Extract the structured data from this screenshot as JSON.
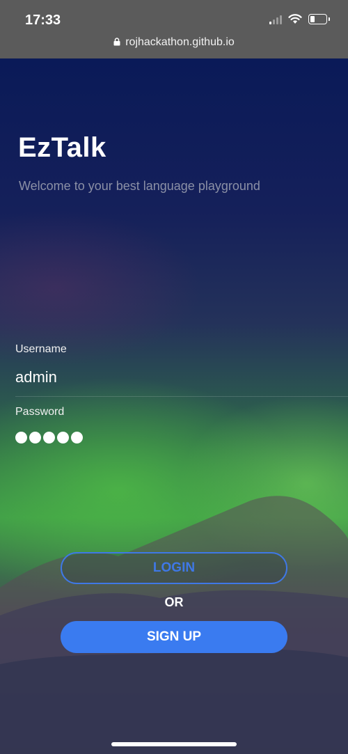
{
  "status_bar": {
    "time": "17:33",
    "url": "rojhackathon.github.io"
  },
  "app": {
    "title": "EzTalk",
    "subtitle": "Welcome to your best language playground"
  },
  "form": {
    "username_label": "Username",
    "username_value": "admin",
    "password_label": "Password",
    "password_masked_length": 5
  },
  "actions": {
    "login_label": "LOGIN",
    "or_label": "OR",
    "signup_label": "SIGN UP"
  },
  "colors": {
    "accent": "#3a7bf0",
    "status_bar_bg": "#5b5b5b"
  },
  "icons": [
    "lock-icon",
    "cellular-signal-icon",
    "wifi-icon",
    "battery-icon"
  ]
}
